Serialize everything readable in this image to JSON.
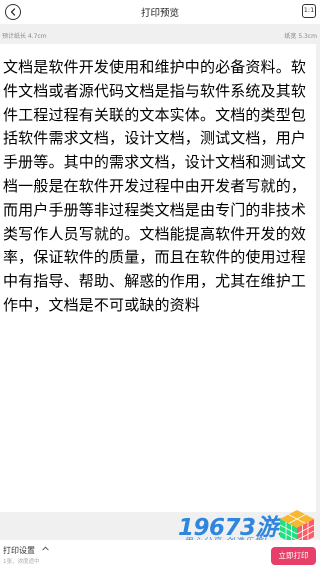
{
  "header": {
    "title": "打印预览",
    "scale_icon_text": "1:1"
  },
  "info": {
    "left": "预计纸长 4.7cm",
    "right": "纸宽 5.3cm"
  },
  "document": {
    "text": "文档是软件开发使用和维护中的必备资料。软件文档或者源代码文档是指与软件系统及其软件工程过程有关联的文本实体。文档的类型包括软件需求文档，设计文档，测试文档，用户手册等。其中的需求文档，设计文档和测试文档一般是在软件开发过程中由开发者写就的，而用户手册等非过程类文档是由专门的非技术类写作人员写就的。文档能提高软件开发的效率，保证软件的质量，而且在软件的使用过程中有指导、帮助、解惑的作用，尤其在维护工作中，文档是不可或缺的资料"
  },
  "footer": {
    "settings_label": "打印设置",
    "sub_label": "1张，浓度适中",
    "print_button": "立即打印"
  },
  "watermark": {
    "text": "19673游戏",
    "slogan": "用心分享 创造乐趣!"
  },
  "colors": {
    "accent": "#e6406a",
    "watermark": "#2e86de"
  }
}
